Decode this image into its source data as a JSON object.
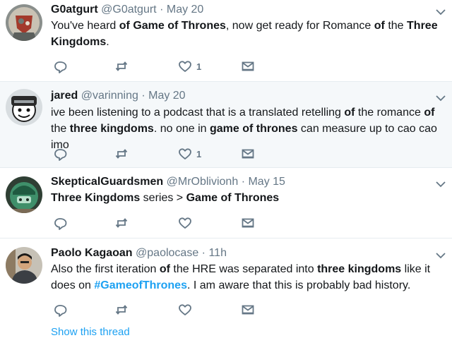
{
  "tweets": [
    {
      "name": "G0atgurt",
      "handle": "@G0atgurt",
      "separator": "·",
      "date": "May 20",
      "body": [
        {
          "t": "You've heard "
        },
        {
          "t": "of Game of Thrones",
          "b": true
        },
        {
          "t": ", now get ready for Romance "
        },
        {
          "t": "of",
          "b": true
        },
        {
          "t": " the "
        },
        {
          "t": "Three Kingdoms",
          "b": true
        },
        {
          "t": "."
        }
      ],
      "likes": "1",
      "avatar_icon": "shield-knight-avatar",
      "alt": false
    },
    {
      "name": "jared",
      "handle": "@varinning",
      "separator": "·",
      "date": "May 20",
      "body": [
        {
          "t": "ive been listening to a podcast that is a translated retelling "
        },
        {
          "t": "of",
          "b": true
        },
        {
          "t": " the romance "
        },
        {
          "t": "of",
          "b": true
        },
        {
          "t": " the "
        },
        {
          "t": "three kingdoms",
          "b": true
        },
        {
          "t": ". no one in "
        },
        {
          "t": "game of thrones",
          "b": true
        },
        {
          "t": " can measure up to cao cao imo"
        }
      ],
      "likes": "1",
      "avatar_icon": "cartoon-face-avatar",
      "alt": true
    },
    {
      "name": "SkepticalGuardsmen",
      "handle": "@MrOblivionh",
      "separator": "·",
      "date": "May 15",
      "body": [
        {
          "t": "Three Kingdoms",
          "b": true
        },
        {
          "t": " series > "
        },
        {
          "t": "Game of Thrones",
          "b": true
        }
      ],
      "likes": "",
      "avatar_icon": "green-helmet-avatar",
      "alt": false
    },
    {
      "name": "Paolo Kagaoan",
      "handle": "@paolocase",
      "separator": "·",
      "date": "11h",
      "body": [
        {
          "t": "Also the first iteration "
        },
        {
          "t": "of",
          "b": true
        },
        {
          "t": " the HRE was separated into "
        },
        {
          "t": "three kingdoms",
          "b": true
        },
        {
          "t": " like it does on "
        },
        {
          "t": "#GameofThrones",
          "h": true
        },
        {
          "t": ". I am aware that this is probably bad history."
        }
      ],
      "likes": "",
      "avatar_icon": "person-photo-avatar",
      "alt": false
    }
  ],
  "show_thread": "Show this thread",
  "colors": {
    "accent": "#1da1f2",
    "muted": "#657786",
    "text": "#14171a",
    "alt_background": "#f5f8fa",
    "divider": "#e6ecf0"
  },
  "icons": [
    "reply-icon",
    "retweet-icon",
    "like-icon",
    "message-icon",
    "chevron-down-icon"
  ]
}
